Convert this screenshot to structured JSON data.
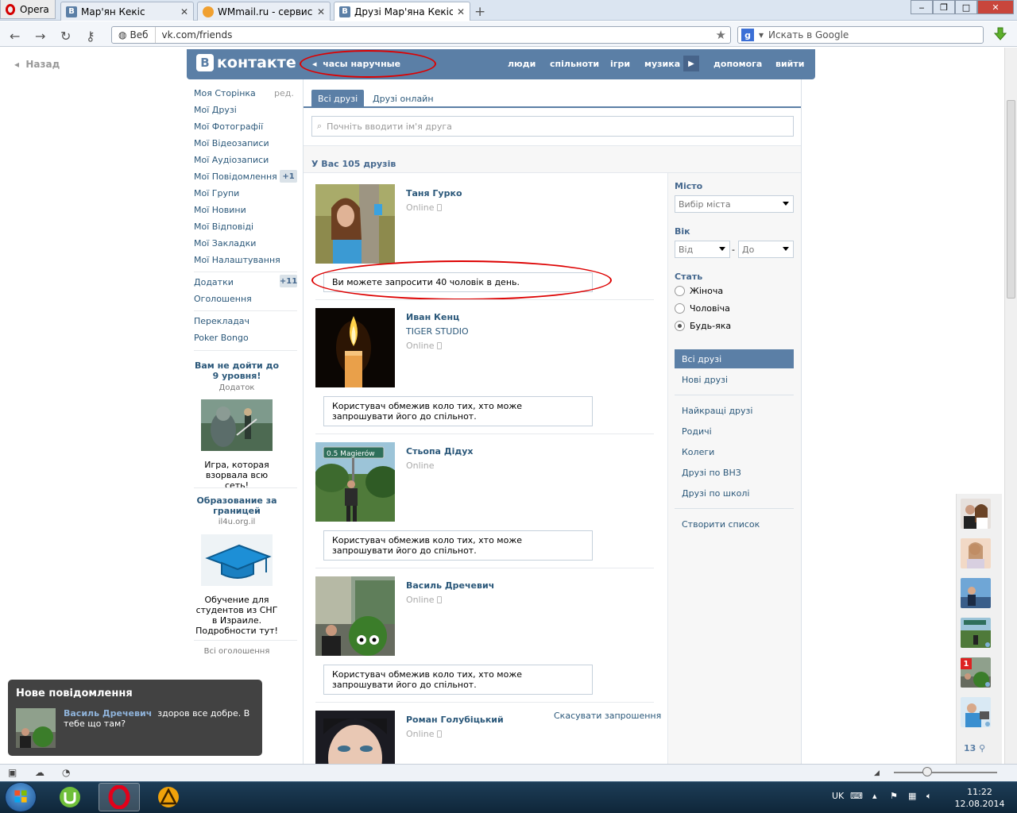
{
  "browser": {
    "menu_label": "Opera",
    "tabs": [
      {
        "title": "Мар'ян Кекіс",
        "close": "✕"
      },
      {
        "title": "WMmail.ru - сервис п...",
        "close": "✕"
      },
      {
        "title": "Друзі Мар'яна Кекіса |...",
        "close": "✕"
      }
    ],
    "new_tab": "+",
    "address_mode": "Веб",
    "url": "vk.com/friends",
    "search_placeholder": "Искать в Google"
  },
  "vk": {
    "back_label": "Назад",
    "logo_text": "контакте",
    "status_text": "часы наручные",
    "topnav": [
      "люди",
      "спільноти",
      "ігри",
      "музика",
      "допомога",
      "вийти"
    ],
    "leftnav": [
      "Моя Сторінка",
      "Мої Друзі",
      "Мої Фотографії",
      "Мої Відеозаписи",
      "Мої Аудіозаписи",
      "Мої Повідомлення",
      "Мої Групи",
      "Мої Новини",
      "Мої Відповіді",
      "Мої Закладки",
      "Мої Налаштування"
    ],
    "edit_label": "ред.",
    "messages_count": "+1",
    "apps_label": "Додатки",
    "apps_count": "+11",
    "ads_link": "Оголошення",
    "extra_links": [
      "Перекладач",
      "Poker Bongo"
    ],
    "ads": [
      {
        "title": "Вам не дойти до 9 уровня!",
        "sub": "Додаток",
        "text": "Игра, которая взорвала всю сеть!"
      },
      {
        "title": "Образование за границей",
        "sub": "il4u.org.il",
        "text": "Обучение для студентов из СНГ в Израиле. Подробности тут!"
      }
    ],
    "all_ads": "Всі оголошення",
    "tabs": [
      "Всі друзі",
      "Друзі онлайн"
    ],
    "search_placeholder": "Почніть вводити ім'я друга",
    "friends_count": "У Вас 105 друзів",
    "invite_note": "Ви можете запросити 40 чоловік в день.",
    "restricted_note": "Користувач обмежив коло тих, хто може запрошувати його до спільнот.",
    "online_label": "Online",
    "cancel_invite": "Скасувати запрошення",
    "friends": [
      {
        "name": "Таня Гурко",
        "sub": ""
      },
      {
        "name": "Иван Кенц",
        "sub": "TIGER STUDIO"
      },
      {
        "name": "Стьопа Дідух",
        "sub": "",
        "sign": "0.5 Magierów"
      },
      {
        "name": "Василь Дречевич",
        "sub": ""
      },
      {
        "name": "Роман Голубіцький",
        "sub": ""
      }
    ],
    "filter": {
      "city_title": "Місто",
      "city_select": "Вибір міста",
      "age_title": "Вік",
      "age_from": "Від",
      "age_dash": "-",
      "age_to": "До",
      "sex_title": "Стать",
      "sex_options": [
        "Жіноча",
        "Чоловіча",
        "Будь-яка"
      ],
      "sex_selected": "Будь-яка",
      "lists_active": "Всі друзі",
      "lists": [
        "Нові друзі",
        "Найкращі друзі",
        "Родичі",
        "Колеги",
        "Друзі по ВНЗ",
        "Друзі по школі",
        "Створити список"
      ]
    },
    "online_sidebar": {
      "badge": "1",
      "count": "13"
    },
    "notification": {
      "title": "Нове повідомлення",
      "sender": "Василь Дречевич",
      "message": "здоров все добре. В тебе що там?"
    }
  },
  "taskbar": {
    "lang": "UK",
    "time": "11:22",
    "date": "12.08.2014"
  }
}
